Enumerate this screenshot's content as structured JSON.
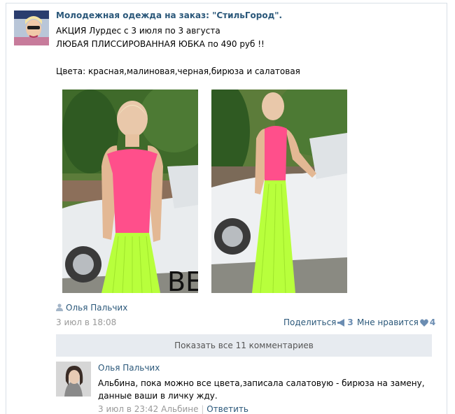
{
  "post": {
    "author": "Молодежная одежда на заказ: \"СтильГород\".",
    "lines": [
      "АКЦИЯ Лурдес с 3 июля по 3 августа",
      "ЛЮБАЯ ПЛИССИРОВАННАЯ ЮБКА по 490 руб !!",
      "Цвета: красная,малиновая,черная,бирюза и салатовая"
    ],
    "photo_caption": "BEBE",
    "signer": "Олья Пальчих",
    "date": "3 июл в 18:08",
    "share_label": "Поделиться",
    "share_count": "3",
    "like_label": "Мне нравится",
    "like_count": "4"
  },
  "comments": {
    "show_all_label": "Показать все 11 комментариев",
    "items": [
      {
        "author": "Олья Пальчих",
        "text": "Альбина, пока можно все цвета,записала салатовую - бирюза на замену, данные ваши в личку жду.",
        "meta": "3 июл в 23:42 Альбине",
        "separator": "|",
        "reply_label": "Ответить"
      }
    ]
  },
  "colors": {
    "link": "#2b587a",
    "muted": "#999999",
    "button_bg": "#e7ebf0"
  }
}
